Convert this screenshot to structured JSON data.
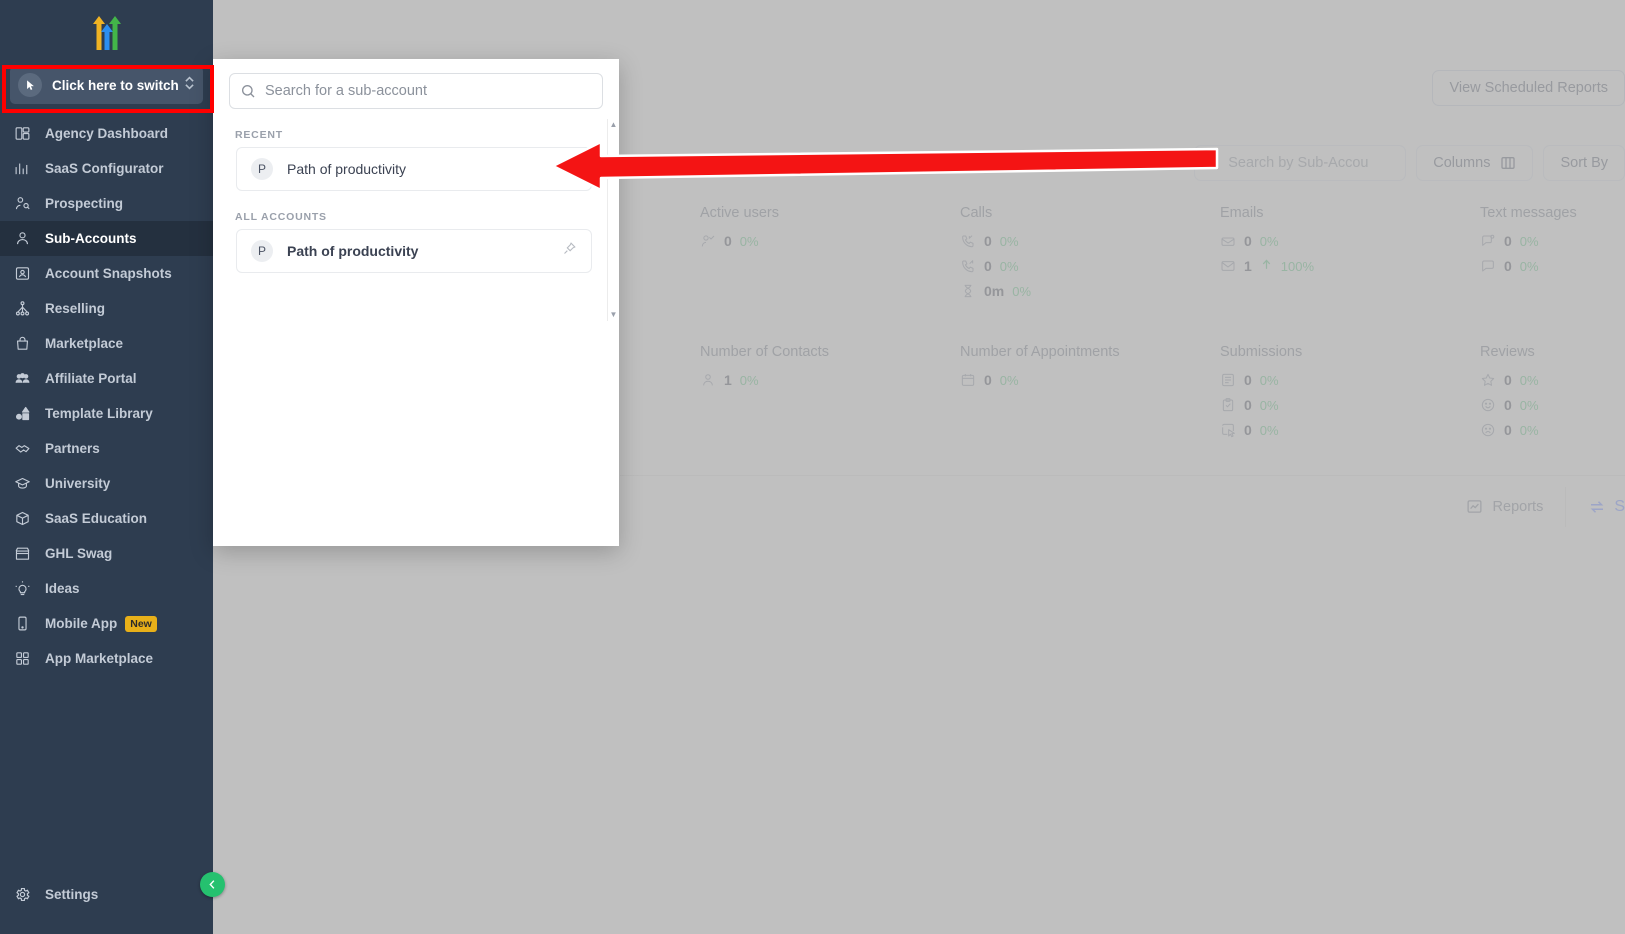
{
  "brand": {
    "logo_name": "three-arrows-logo",
    "accent_green": "#25c16f",
    "sidebar_bg": "#2e3d50",
    "annotation_color": "#ff0000"
  },
  "sidebar": {
    "switcher": {
      "label": "Click here to switch",
      "icon": "cursor-click-icon",
      "chevron": "chevron-up-down-icon",
      "highlighted": true
    },
    "items": [
      {
        "label": "Agency Dashboard",
        "icon": "dashboard-icon",
        "active": false
      },
      {
        "label": "SaaS Configurator",
        "icon": "bar-chart-icon",
        "active": false
      },
      {
        "label": "Prospecting",
        "icon": "user-search-icon",
        "active": false
      },
      {
        "label": "Sub-Accounts",
        "icon": "user-icon",
        "active": true
      },
      {
        "label": "Account Snapshots",
        "icon": "snapshot-icon",
        "active": false
      },
      {
        "label": "Reselling",
        "icon": "network-icon",
        "active": false
      },
      {
        "label": "Marketplace",
        "icon": "bag-icon",
        "active": false
      },
      {
        "label": "Affiliate Portal",
        "icon": "people-icon",
        "active": false
      },
      {
        "label": "Template Library",
        "icon": "shapes-icon",
        "active": false
      },
      {
        "label": "Partners",
        "icon": "handshake-icon",
        "active": false
      },
      {
        "label": "University",
        "icon": "graduation-cap-icon",
        "active": false
      },
      {
        "label": "SaaS Education",
        "icon": "box-icon",
        "active": false
      },
      {
        "label": "GHL Swag",
        "icon": "store-icon",
        "active": false
      },
      {
        "label": "Ideas",
        "icon": "lightbulb-icon",
        "active": false
      },
      {
        "label": "Mobile App",
        "icon": "mobile-phone-icon",
        "active": false,
        "badge": "New"
      },
      {
        "label": "App Marketplace",
        "icon": "grid-icon",
        "active": false
      }
    ],
    "bottom": {
      "label": "Settings",
      "icon": "gear-icon"
    },
    "collapse": {
      "icon": "chevron-left-icon"
    }
  },
  "switch_panel": {
    "search": {
      "placeholder": "Search for a sub-account",
      "value": "",
      "icon": "search-icon"
    },
    "sections": [
      {
        "label": "RECENT",
        "accounts": [
          {
            "initial": "P",
            "name": "Path of productivity",
            "bold": false,
            "pinned": false
          }
        ]
      },
      {
        "label": "ALL ACCOUNTS",
        "accounts": [
          {
            "initial": "P",
            "name": "Path of productivity",
            "bold": true,
            "pinned": true,
            "pin_icon": "pin-icon"
          }
        ]
      }
    ],
    "scrollbar": {
      "up_icon": "caret-up-icon",
      "down_icon": "caret-down-icon"
    }
  },
  "main": {
    "view_scheduled_reports": "View Scheduled Reports",
    "search": {
      "placeholder": "Search by Sub-Accou",
      "icon": "search-icon"
    },
    "columns_button": {
      "label": "Columns",
      "icon": "columns-icon"
    },
    "sort_button": {
      "label": "Sort By"
    },
    "stats": [
      {
        "title": "Active users",
        "rows": [
          {
            "icon": "user-check-icon",
            "value": "0",
            "pct": "0%",
            "trend": "none"
          }
        ]
      },
      {
        "title": "Calls",
        "rows": [
          {
            "icon": "call-incoming-icon",
            "value": "0",
            "pct": "0%",
            "trend": "none"
          },
          {
            "icon": "call-outgoing-icon",
            "value": "0",
            "pct": "0%",
            "trend": "none"
          },
          {
            "icon": "hourglass-icon",
            "value": "0m",
            "pct": "0%",
            "trend": "none"
          }
        ]
      },
      {
        "title": "Emails",
        "rows": [
          {
            "icon": "mail-open-icon",
            "value": "0",
            "pct": "0%",
            "trend": "none"
          },
          {
            "icon": "mail-icon",
            "value": "1",
            "pct": "100%",
            "trend": "up"
          }
        ]
      },
      {
        "title": "Text messages",
        "rows": [
          {
            "icon": "message-incoming-icon",
            "value": "0",
            "pct": "0%",
            "trend": "none"
          },
          {
            "icon": "message-icon",
            "value": "0",
            "pct": "0%",
            "trend": "none"
          }
        ]
      },
      {
        "title": "Number of Contacts",
        "rows": [
          {
            "icon": "contact-icon",
            "value": "1",
            "pct": "0%",
            "trend": "none"
          }
        ]
      },
      {
        "title": "Number of Appointments",
        "rows": [
          {
            "icon": "calendar-icon",
            "value": "0",
            "pct": "0%",
            "trend": "none"
          }
        ]
      },
      {
        "title": "Submissions",
        "rows": [
          {
            "icon": "form-icon",
            "value": "0",
            "pct": "0%",
            "trend": "none"
          },
          {
            "icon": "clipboard-check-icon",
            "value": "0",
            "pct": "0%",
            "trend": "none"
          },
          {
            "icon": "cursor-box-icon",
            "value": "0",
            "pct": "0%",
            "trend": "none"
          }
        ]
      },
      {
        "title": "Reviews",
        "rows": [
          {
            "icon": "star-icon",
            "value": "0",
            "pct": "0%",
            "trend": "none"
          },
          {
            "icon": "smile-icon",
            "value": "0",
            "pct": "0%",
            "trend": "none"
          },
          {
            "icon": "frown-icon",
            "value": "0",
            "pct": "0%",
            "trend": "none"
          }
        ]
      }
    ],
    "footer": {
      "reports": {
        "label": "Reports",
        "icon": "chart-image-icon"
      },
      "switch": {
        "label": "S",
        "icon": "swap-arrows-icon"
      }
    }
  }
}
